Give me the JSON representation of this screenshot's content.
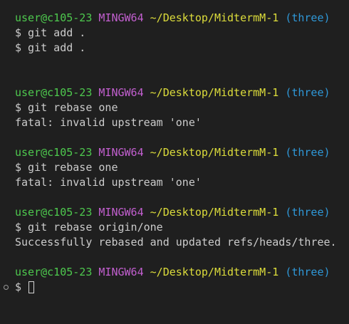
{
  "prompt": {
    "user": "user@c105-23",
    "shell": "MINGW64",
    "path": "~/Desktop/MidtermM-1",
    "branch": "(three)"
  },
  "blocks": [
    {
      "commands": [
        "$ git add .",
        "$ git add ."
      ],
      "output": []
    },
    {
      "commands": [
        "$ git rebase one"
      ],
      "output": [
        "fatal: invalid upstream 'one'"
      ]
    },
    {
      "commands": [
        "$ git rebase one"
      ],
      "output": [
        "fatal: invalid upstream 'one'"
      ]
    },
    {
      "commands": [
        "$ git rebase origin/one"
      ],
      "output": [
        "Successfully rebased and updated refs/heads/three."
      ]
    }
  ],
  "current": {
    "prompt_symbol": "$"
  },
  "colors": {
    "background": "#1f1f1f",
    "user": "#4ec94e",
    "shell": "#c25fcf",
    "path": "#dcdc3b",
    "branch": "#2f98d8",
    "text": "#cccccc"
  }
}
